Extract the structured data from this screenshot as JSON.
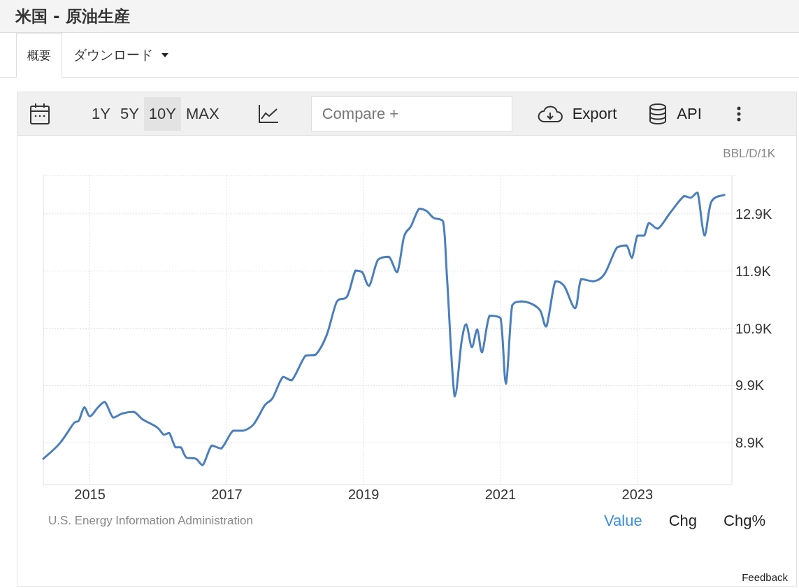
{
  "title": "米国 - 原油生産",
  "tabs": [
    {
      "label": "概要",
      "selected": true,
      "kind": "tab"
    },
    {
      "label": "ダウンロード",
      "selected": false,
      "kind": "dropdown"
    }
  ],
  "toolbar": {
    "ranges": [
      {
        "label": "1Y",
        "selected": false
      },
      {
        "label": "5Y",
        "selected": false
      },
      {
        "label": "10Y",
        "selected": true
      },
      {
        "label": "MAX",
        "selected": false
      }
    ],
    "compare": {
      "placeholder": "Compare +"
    },
    "export": "Export",
    "api": "API"
  },
  "chart": {
    "chart_data": {
      "type": "line",
      "grid": true,
      "ylabel": "BBL/D/1K",
      "xlim": [
        2014.32,
        2024.35
      ],
      "ylim": [
        8170,
        13570
      ],
      "xticks": [
        2015,
        2017,
        2019,
        2021,
        2023
      ],
      "yticks": [
        {
          "value": 8900,
          "label": "8.9K"
        },
        {
          "value": 9900,
          "label": "9.9K"
        },
        {
          "value": 10900,
          "label": "10.9K"
        },
        {
          "value": 11900,
          "label": "11.9K"
        },
        {
          "value": 12900,
          "label": "12.9K"
        }
      ],
      "x": [
        2014.32,
        2014.56,
        2014.77,
        2014.84,
        2014.92,
        2015.0,
        2015.12,
        2015.22,
        2015.34,
        2015.47,
        2015.64,
        2015.77,
        2015.98,
        2016.08,
        2016.16,
        2016.25,
        2016.33,
        2016.41,
        2016.55,
        2016.65,
        2016.78,
        2016.92,
        2017.09,
        2017.24,
        2017.39,
        2017.56,
        2017.67,
        2017.82,
        2017.95,
        2018.15,
        2018.3,
        2018.46,
        2018.61,
        2018.76,
        2018.88,
        2018.98,
        2019.08,
        2019.21,
        2019.37,
        2019.49,
        2019.59,
        2019.69,
        2019.81,
        2019.92,
        2020.02,
        2020.16,
        2020.22,
        2020.33,
        2020.43,
        2020.5,
        2020.58,
        2020.66,
        2020.73,
        2020.84,
        2021.0,
        2021.08,
        2021.17,
        2021.3,
        2021.45,
        2021.58,
        2021.67,
        2021.8,
        2021.93,
        2022.09,
        2022.18,
        2022.36,
        2022.52,
        2022.7,
        2022.84,
        2022.92,
        2023.0,
        2023.1,
        2023.17,
        2023.3,
        2023.48,
        2023.68,
        2023.78,
        2023.88,
        2023.98,
        2024.08,
        2024.27
      ],
      "series": [
        {
          "color": "#4a7fbf",
          "values": [
            8620,
            8890,
            9250,
            9290,
            9520,
            9360,
            9520,
            9610,
            9340,
            9410,
            9440,
            9310,
            9170,
            9040,
            9070,
            8820,
            8820,
            8640,
            8620,
            8510,
            8850,
            8800,
            9110,
            9110,
            9220,
            9560,
            9680,
            10050,
            9990,
            10420,
            10440,
            10780,
            11370,
            11460,
            11910,
            11880,
            11640,
            12100,
            12150,
            11880,
            12500,
            12680,
            12990,
            12950,
            12830,
            12770,
            11760,
            9710,
            10660,
            10970,
            10570,
            10880,
            10480,
            11120,
            11080,
            9930,
            11300,
            11370,
            11330,
            11210,
            10930,
            11720,
            11640,
            11250,
            11760,
            11720,
            11850,
            12310,
            12350,
            12130,
            12520,
            12520,
            12740,
            12640,
            12920,
            13210,
            13180,
            13270,
            12520,
            13110,
            13230
          ]
        }
      ]
    }
  },
  "source": "U.S. Energy Information Administration",
  "modes": [
    {
      "label": "Value",
      "selected": true
    },
    {
      "label": "Chg",
      "selected": false
    },
    {
      "label": "Chg%",
      "selected": false
    }
  ],
  "feedback": "Feedback"
}
